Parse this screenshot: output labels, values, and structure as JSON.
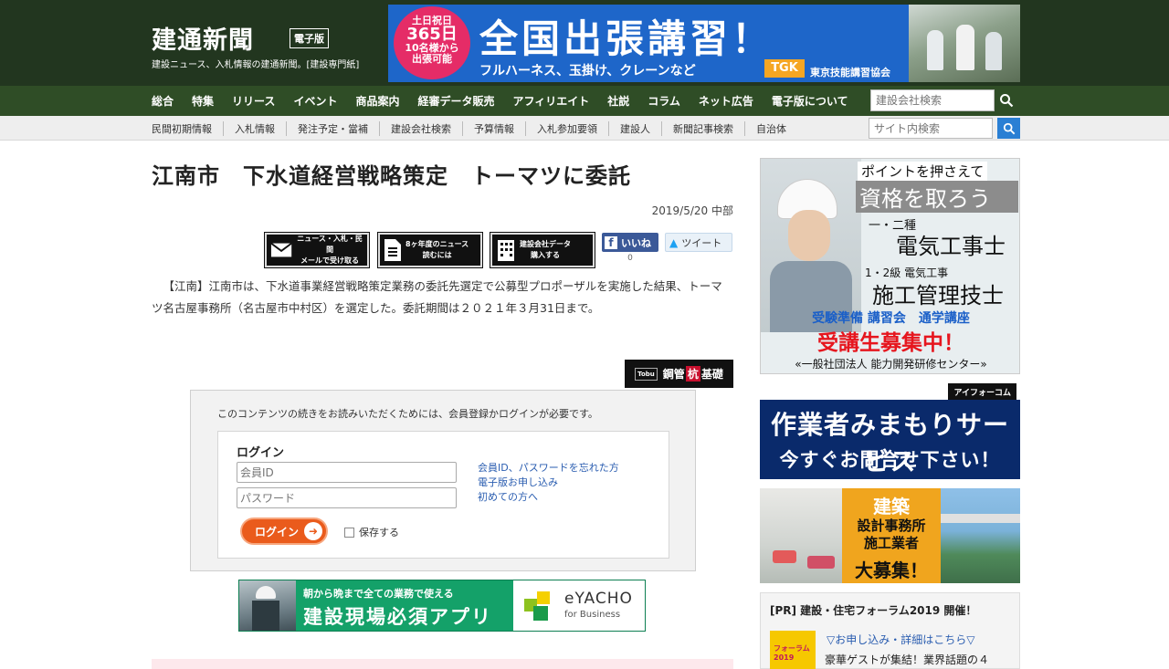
{
  "header": {
    "logo": "建通新聞",
    "edition_badge": "電子版",
    "tagline": "建設ニュース、入札情報の建通新聞。[建設専門紙]"
  },
  "top_banner": {
    "badge_line1": "土日祝日",
    "badge_line2": "365日",
    "badge_line3": "10名様から",
    "badge_line4": "出張可能",
    "headline": "全国出張講習！",
    "subtext": "フルハーネス、玉掛け、クレーンなど",
    "logo": "TGK",
    "association": "東京技能講習協会"
  },
  "nav_primary": [
    "総合",
    "特集",
    "リリース",
    "イベント",
    "商品案内",
    "経審データ販売",
    "アフィリエイト",
    "社説",
    "コラム",
    "ネット広告",
    "電子版について"
  ],
  "company_search": {
    "placeholder": "建設会社検索"
  },
  "nav_secondary": [
    "民間初期情報",
    "入札情報",
    "発注予定・當補",
    "建設会社検索",
    "予算情報",
    "入札参加要領",
    "建設人",
    "新聞記事検索",
    "自治体"
  ],
  "site_search": {
    "placeholder": "サイト内検索"
  },
  "article": {
    "title": "江南市　下水道経営戦略策定　トーマツに委託",
    "date": "2019/5/20 中部",
    "body": "【江南】江南市は、下水道事業経営戦略策定業務の委託先選定で公募型プロポーザルを実施した結果、トーマツ名古屋事務所（名古屋市中村区）を選定した。委託期間は２０２１年３月31日まで。"
  },
  "share": {
    "mail_line1": "ニュース・入札・民間",
    "mail_line2": "メールで受け取る",
    "news_line1": "8ヶ年度のニュース",
    "news_line2": "読むには",
    "company_line1": "建設会社データ",
    "company_line2": "購入する",
    "like_label": "いいね",
    "like_count": "0",
    "tweet_label": "ツイート"
  },
  "pipe_ad": {
    "mark": "Tobu",
    "text_a": "鋼管",
    "text_b": "杭",
    "text_c": "基礎"
  },
  "login": {
    "note": "このコンテンツの続きをお読みいただくためには、会員登録かログインが必要です。",
    "heading": "ログイン",
    "id_placeholder": "会員ID",
    "pw_placeholder": "パスワード",
    "forgot_link": "会員ID、パスワードを忘れた方",
    "apply_link": "電子版お申し込み",
    "first_link": "初めての方へ",
    "button": "ログイン",
    "remember": "保存する"
  },
  "eyacho_ad": {
    "line1": "朝から晩まで全ての業務で使える",
    "line2": "建設現場必須アプリ",
    "brand": "eYACHO",
    "brand_sub": "for Business"
  },
  "sidebar": {
    "qual_ad": {
      "t1": "ポイントを押さえて",
      "t2": "資格を取ろう",
      "t3": "一・二種",
      "t4": "電気工事士",
      "t5": "1・2級 電気工事",
      "t6": "施工管理技士",
      "t7": "受験準備 講習会　通学講座",
      "t8": "受講生募集中！",
      "t9": "«一般社団法人 能力開発研修センター»"
    },
    "iform_ad": {
      "brand": "アイフォーコム",
      "line1": "作業者みまもりサービス",
      "line2": "今すぐお問合せ下さい！"
    },
    "hire_ad": {
      "line1": "建築",
      "line2": "設計事務所",
      "line3": "施工業者",
      "line4": "大募集！"
    },
    "forum": {
      "title": "[PR] 建設・住宅フォーラム2019 開催！",
      "thumb_text": "フォーラム2019",
      "link": "▽お申し込み・詳細はこちら▽",
      "desc": "豪華ゲストが集結！業界話題の４"
    }
  },
  "colors": {
    "header_bg": "#22361f",
    "nav_bg": "#2f4d26",
    "search_blue": "#2a7fd4",
    "login_orange": "#ea5b1c",
    "facebook": "#3b5998"
  }
}
